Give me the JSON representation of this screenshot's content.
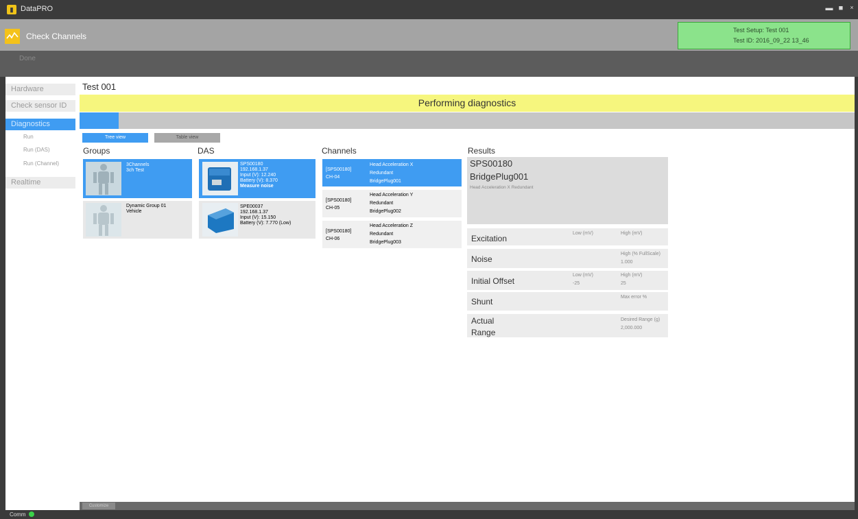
{
  "window": {
    "app_title": "DataPRO",
    "app_icon": "datapro-logo-icon",
    "controls": [
      "minimize-icon",
      "maximize-icon",
      "close-icon"
    ]
  },
  "header": {
    "mode_title": "Check Channels",
    "mode_icon": "check-channels-icon",
    "test_setup": "Test Setup: Test 001",
    "test_id": "Test ID: 2016_09_22 13_46"
  },
  "toolbar": {
    "done_label": "Done"
  },
  "sidebar": {
    "items": [
      {
        "label": "Hardware",
        "active": false
      },
      {
        "label": "Check sensor ID",
        "active": false
      },
      {
        "label": "Diagnostics",
        "active": true
      },
      {
        "label": "Realtime",
        "active": false
      }
    ],
    "subitems": [
      "Run",
      "Run (DAS)",
      "Run (Channel)"
    ]
  },
  "main": {
    "title": "Test 001",
    "banner": "Performing diagnostics",
    "views": {
      "tree": "Tree view",
      "table": "Table view"
    },
    "columns": {
      "groups": "Groups",
      "das": "DAS",
      "channels": "Channels",
      "results": "Results"
    },
    "groups": [
      {
        "line1": "3Channels",
        "line2": "3ch Test",
        "selected": true
      },
      {
        "line1": "Dynamic Group 01",
        "line2": "Vehicle",
        "selected": false
      }
    ],
    "das": [
      {
        "serial": "SPS00180",
        "ip": "192.168.1.37",
        "input": "Input (V):  12.240",
        "battery": "Battery (V):  8.370",
        "action": "Measure noise",
        "selected": true
      },
      {
        "serial": "SPE00037",
        "ip": "192.168.1.37",
        "input": "Input (V):  15.150",
        "battery": "Battery (V):  7.770 (Low)",
        "action": "",
        "selected": false
      }
    ],
    "channels": [
      {
        "das": "[SPS00180]",
        "ch": "CH-04",
        "name": "Head Acceleration X",
        "mode": "Redundant",
        "bridge": "BridgePlug001",
        "selected": true
      },
      {
        "das": "[SPS00180]",
        "ch": "CH-05",
        "name": "Head Acceleration Y",
        "mode": "Redundant",
        "bridge": "BridgePlug002",
        "selected": false
      },
      {
        "das": "[SPS00180]",
        "ch": "CH-06",
        "name": "Head Acceleration Z",
        "mode": "Redundant",
        "bridge": "BridgePlug003",
        "selected": false
      }
    ],
    "results": {
      "serial": "SPS00180",
      "bridge": "BridgePlug001",
      "desc": "Head Acceleration X Redundant",
      "rows": [
        {
          "label": "Excitation",
          "c1h": "Low (mV)",
          "c1v": "",
          "c2h": "High (mV)",
          "c2v": ""
        },
        {
          "label": "Noise",
          "c1h": "",
          "c1v": "",
          "c2h": "High (% FullScale)",
          "c2v": "1.000"
        },
        {
          "label": "Initial Offset",
          "c1h": "Low (mV)",
          "c1v": "-25",
          "c2h": "High (mV)",
          "c2v": "25"
        },
        {
          "label": "Shunt",
          "c1h": "",
          "c1v": "",
          "c2h": "Max error %",
          "c2v": ""
        },
        {
          "label": "Actual",
          "label2": "Range",
          "c1h": "",
          "c1v": "",
          "c2h": "Desired Range (g)",
          "c2v": "2,000.000"
        }
      ]
    }
  },
  "bottom": {
    "button": "Customize"
  },
  "status": {
    "comm": "Comm",
    "comm_color": "#3bd14a"
  },
  "colors": {
    "accent": "#3f9cf2",
    "banner": "#f6f67e",
    "status_ok": "#8be38b"
  }
}
